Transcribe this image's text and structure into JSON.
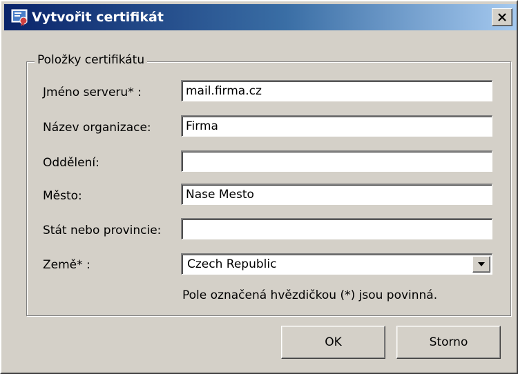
{
  "window": {
    "title": "Vytvořit certifikát",
    "title_icon": "certificate-icon",
    "close_icon": "close-icon",
    "colors": {
      "titlebar_start": "#0a246a",
      "titlebar_end": "#a6caf0",
      "face": "#d4d0c8"
    }
  },
  "group": {
    "title": "Položky certifikátu"
  },
  "fields": [
    {
      "label": "Jméno serveru* :",
      "value": "mail.firma.cz"
    },
    {
      "label": "Název organizace:",
      "value": "Firma"
    },
    {
      "label": "Oddělení:",
      "value": ""
    },
    {
      "label": "Město:",
      "value": "Nase Mesto"
    },
    {
      "label": "Stát nebo provincie:",
      "value": ""
    }
  ],
  "country": {
    "label": "Země* :",
    "selected": "Czech Republic",
    "arrow_icon": "chevron-down-icon"
  },
  "note": "Pole označená hvězdičkou (*) jsou povinná.",
  "buttons": {
    "ok": "OK",
    "cancel": "Storno"
  }
}
